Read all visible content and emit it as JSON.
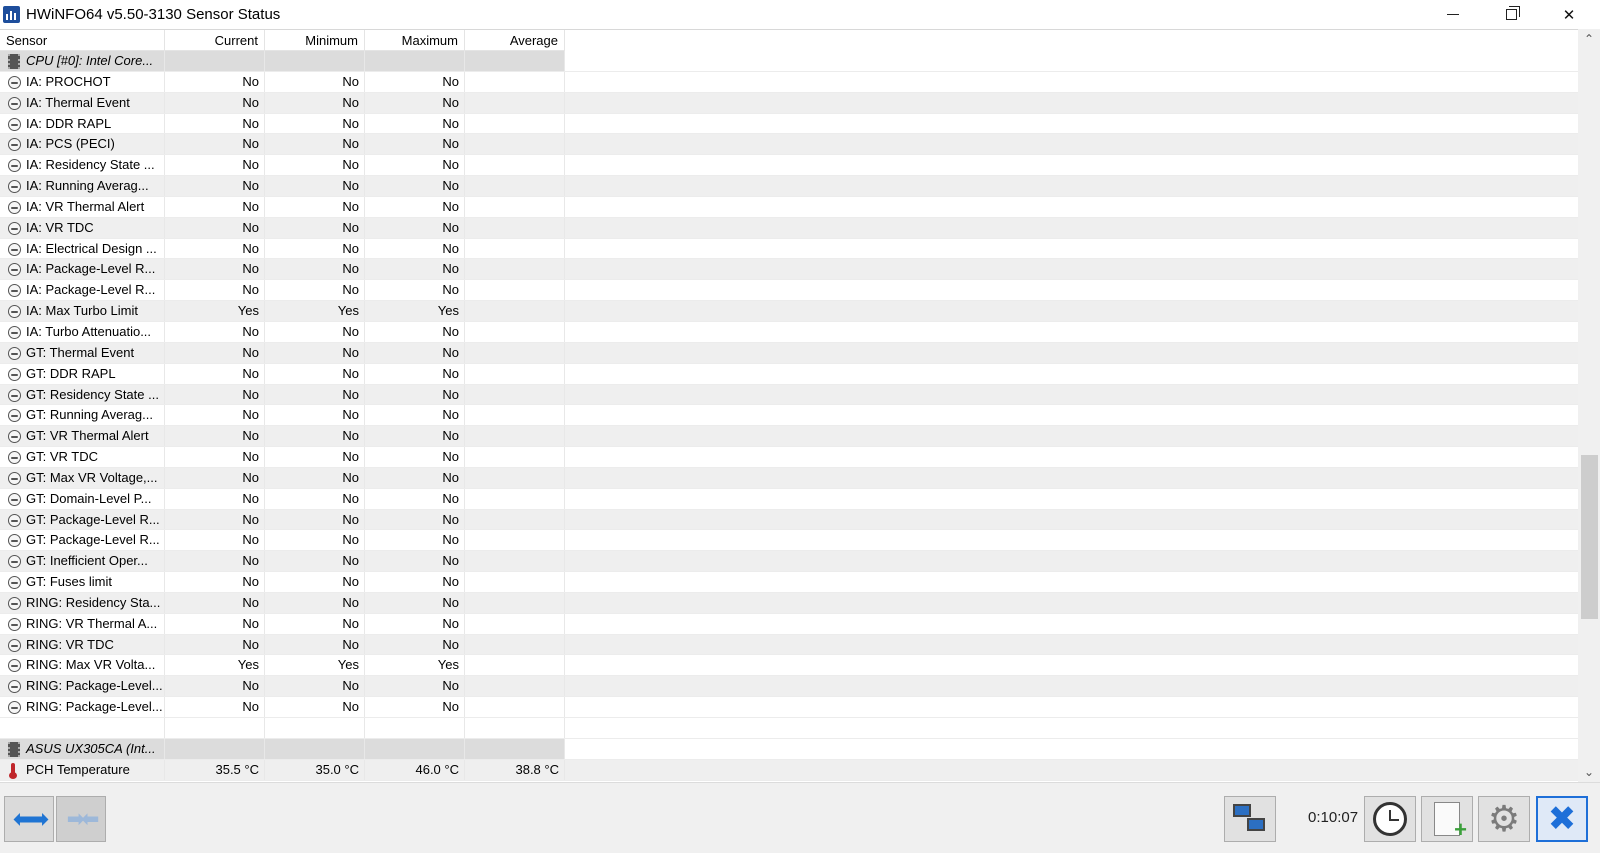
{
  "window": {
    "title": "HWiNFO64 v5.50-3130 Sensor Status"
  },
  "columns": [
    "Sensor",
    "Current",
    "Minimum",
    "Maximum",
    "Average"
  ],
  "rows": [
    {
      "kind": "group",
      "icon": "chip-icon",
      "sensor": "CPU [#0]: Intel Core...",
      "current": "",
      "minimum": "",
      "maximum": "",
      "average": ""
    },
    {
      "kind": "item",
      "icon": "gauge-icon",
      "sensor": "IA: PROCHOT",
      "current": "No",
      "minimum": "No",
      "maximum": "No",
      "average": ""
    },
    {
      "kind": "item",
      "icon": "gauge-icon",
      "sensor": "IA: Thermal Event",
      "current": "No",
      "minimum": "No",
      "maximum": "No",
      "average": ""
    },
    {
      "kind": "item",
      "icon": "gauge-icon",
      "sensor": "IA: DDR RAPL",
      "current": "No",
      "minimum": "No",
      "maximum": "No",
      "average": ""
    },
    {
      "kind": "item",
      "icon": "gauge-icon",
      "sensor": "IA: PCS (PECI)",
      "current": "No",
      "minimum": "No",
      "maximum": "No",
      "average": ""
    },
    {
      "kind": "item",
      "icon": "gauge-icon",
      "sensor": "IA: Residency State ...",
      "current": "No",
      "minimum": "No",
      "maximum": "No",
      "average": ""
    },
    {
      "kind": "item",
      "icon": "gauge-icon",
      "sensor": "IA: Running Averag...",
      "current": "No",
      "minimum": "No",
      "maximum": "No",
      "average": ""
    },
    {
      "kind": "item",
      "icon": "gauge-icon",
      "sensor": "IA: VR Thermal Alert",
      "current": "No",
      "minimum": "No",
      "maximum": "No",
      "average": ""
    },
    {
      "kind": "item",
      "icon": "gauge-icon",
      "sensor": "IA: VR TDC",
      "current": "No",
      "minimum": "No",
      "maximum": "No",
      "average": ""
    },
    {
      "kind": "item",
      "icon": "gauge-icon",
      "sensor": "IA: Electrical Design ...",
      "current": "No",
      "minimum": "No",
      "maximum": "No",
      "average": ""
    },
    {
      "kind": "item",
      "icon": "gauge-icon",
      "sensor": "IA: Package-Level R...",
      "current": "No",
      "minimum": "No",
      "maximum": "No",
      "average": ""
    },
    {
      "kind": "item",
      "icon": "gauge-icon",
      "sensor": "IA: Package-Level R...",
      "current": "No",
      "minimum": "No",
      "maximum": "No",
      "average": ""
    },
    {
      "kind": "item",
      "icon": "gauge-icon",
      "sensor": "IA: Max Turbo Limit",
      "current": "Yes",
      "minimum": "Yes",
      "maximum": "Yes",
      "average": ""
    },
    {
      "kind": "item",
      "icon": "gauge-icon",
      "sensor": "IA: Turbo Attenuatio...",
      "current": "No",
      "minimum": "No",
      "maximum": "No",
      "average": ""
    },
    {
      "kind": "item",
      "icon": "gauge-icon",
      "sensor": "GT: Thermal Event",
      "current": "No",
      "minimum": "No",
      "maximum": "No",
      "average": ""
    },
    {
      "kind": "item",
      "icon": "gauge-icon",
      "sensor": "GT: DDR RAPL",
      "current": "No",
      "minimum": "No",
      "maximum": "No",
      "average": ""
    },
    {
      "kind": "item",
      "icon": "gauge-icon",
      "sensor": "GT: Residency State ...",
      "current": "No",
      "minimum": "No",
      "maximum": "No",
      "average": ""
    },
    {
      "kind": "item",
      "icon": "gauge-icon",
      "sensor": "GT: Running Averag...",
      "current": "No",
      "minimum": "No",
      "maximum": "No",
      "average": ""
    },
    {
      "kind": "item",
      "icon": "gauge-icon",
      "sensor": "GT: VR Thermal Alert",
      "current": "No",
      "minimum": "No",
      "maximum": "No",
      "average": ""
    },
    {
      "kind": "item",
      "icon": "gauge-icon",
      "sensor": "GT: VR TDC",
      "current": "No",
      "minimum": "No",
      "maximum": "No",
      "average": ""
    },
    {
      "kind": "item",
      "icon": "gauge-icon",
      "sensor": "GT: Max VR Voltage,...",
      "current": "No",
      "minimum": "No",
      "maximum": "No",
      "average": ""
    },
    {
      "kind": "item",
      "icon": "gauge-icon",
      "sensor": "GT: Domain-Level P...",
      "current": "No",
      "minimum": "No",
      "maximum": "No",
      "average": ""
    },
    {
      "kind": "item",
      "icon": "gauge-icon",
      "sensor": "GT: Package-Level R...",
      "current": "No",
      "minimum": "No",
      "maximum": "No",
      "average": ""
    },
    {
      "kind": "item",
      "icon": "gauge-icon",
      "sensor": "GT: Package-Level R...",
      "current": "No",
      "minimum": "No",
      "maximum": "No",
      "average": ""
    },
    {
      "kind": "item",
      "icon": "gauge-icon",
      "sensor": "GT: Inefficient Oper...",
      "current": "No",
      "minimum": "No",
      "maximum": "No",
      "average": ""
    },
    {
      "kind": "item",
      "icon": "gauge-icon",
      "sensor": "GT: Fuses limit",
      "current": "No",
      "minimum": "No",
      "maximum": "No",
      "average": ""
    },
    {
      "kind": "item",
      "icon": "gauge-icon",
      "sensor": "RING: Residency Sta...",
      "current": "No",
      "minimum": "No",
      "maximum": "No",
      "average": ""
    },
    {
      "kind": "item",
      "icon": "gauge-icon",
      "sensor": "RING: VR Thermal A...",
      "current": "No",
      "minimum": "No",
      "maximum": "No",
      "average": ""
    },
    {
      "kind": "item",
      "icon": "gauge-icon",
      "sensor": "RING: VR TDC",
      "current": "No",
      "minimum": "No",
      "maximum": "No",
      "average": ""
    },
    {
      "kind": "item",
      "icon": "gauge-icon",
      "sensor": "RING: Max VR Volta...",
      "current": "Yes",
      "minimum": "Yes",
      "maximum": "Yes",
      "average": ""
    },
    {
      "kind": "item",
      "icon": "gauge-icon",
      "sensor": "RING: Package-Level...",
      "current": "No",
      "minimum": "No",
      "maximum": "No",
      "average": ""
    },
    {
      "kind": "item",
      "icon": "gauge-icon",
      "sensor": "RING: Package-Level...",
      "current": "No",
      "minimum": "No",
      "maximum": "No",
      "average": ""
    },
    {
      "kind": "blank",
      "icon": "",
      "sensor": "",
      "current": "",
      "minimum": "",
      "maximum": "",
      "average": ""
    },
    {
      "kind": "group",
      "icon": "chip-icon",
      "sensor": "ASUS UX305CA (Int...",
      "current": "",
      "minimum": "",
      "maximum": "",
      "average": ""
    },
    {
      "kind": "item",
      "icon": "thermometer-icon",
      "sensor": "PCH Temperature",
      "current": "35.5 °C",
      "minimum": "35.0 °C",
      "maximum": "46.0 °C",
      "average": "38.8 °C"
    }
  ],
  "toolbar": {
    "timer": "0:10:07"
  },
  "icons": {
    "app": "hwinfo-app-icon",
    "expand": "expand-arrows-icon",
    "collapse": "collapse-arrows-icon",
    "network": "network-icon",
    "clock": "clock-icon",
    "report": "add-report-icon",
    "settings": "gear-icon",
    "close": "close-icon"
  },
  "colors": {
    "accent": "#1e6fd8",
    "thermometer": "#c0262b"
  }
}
